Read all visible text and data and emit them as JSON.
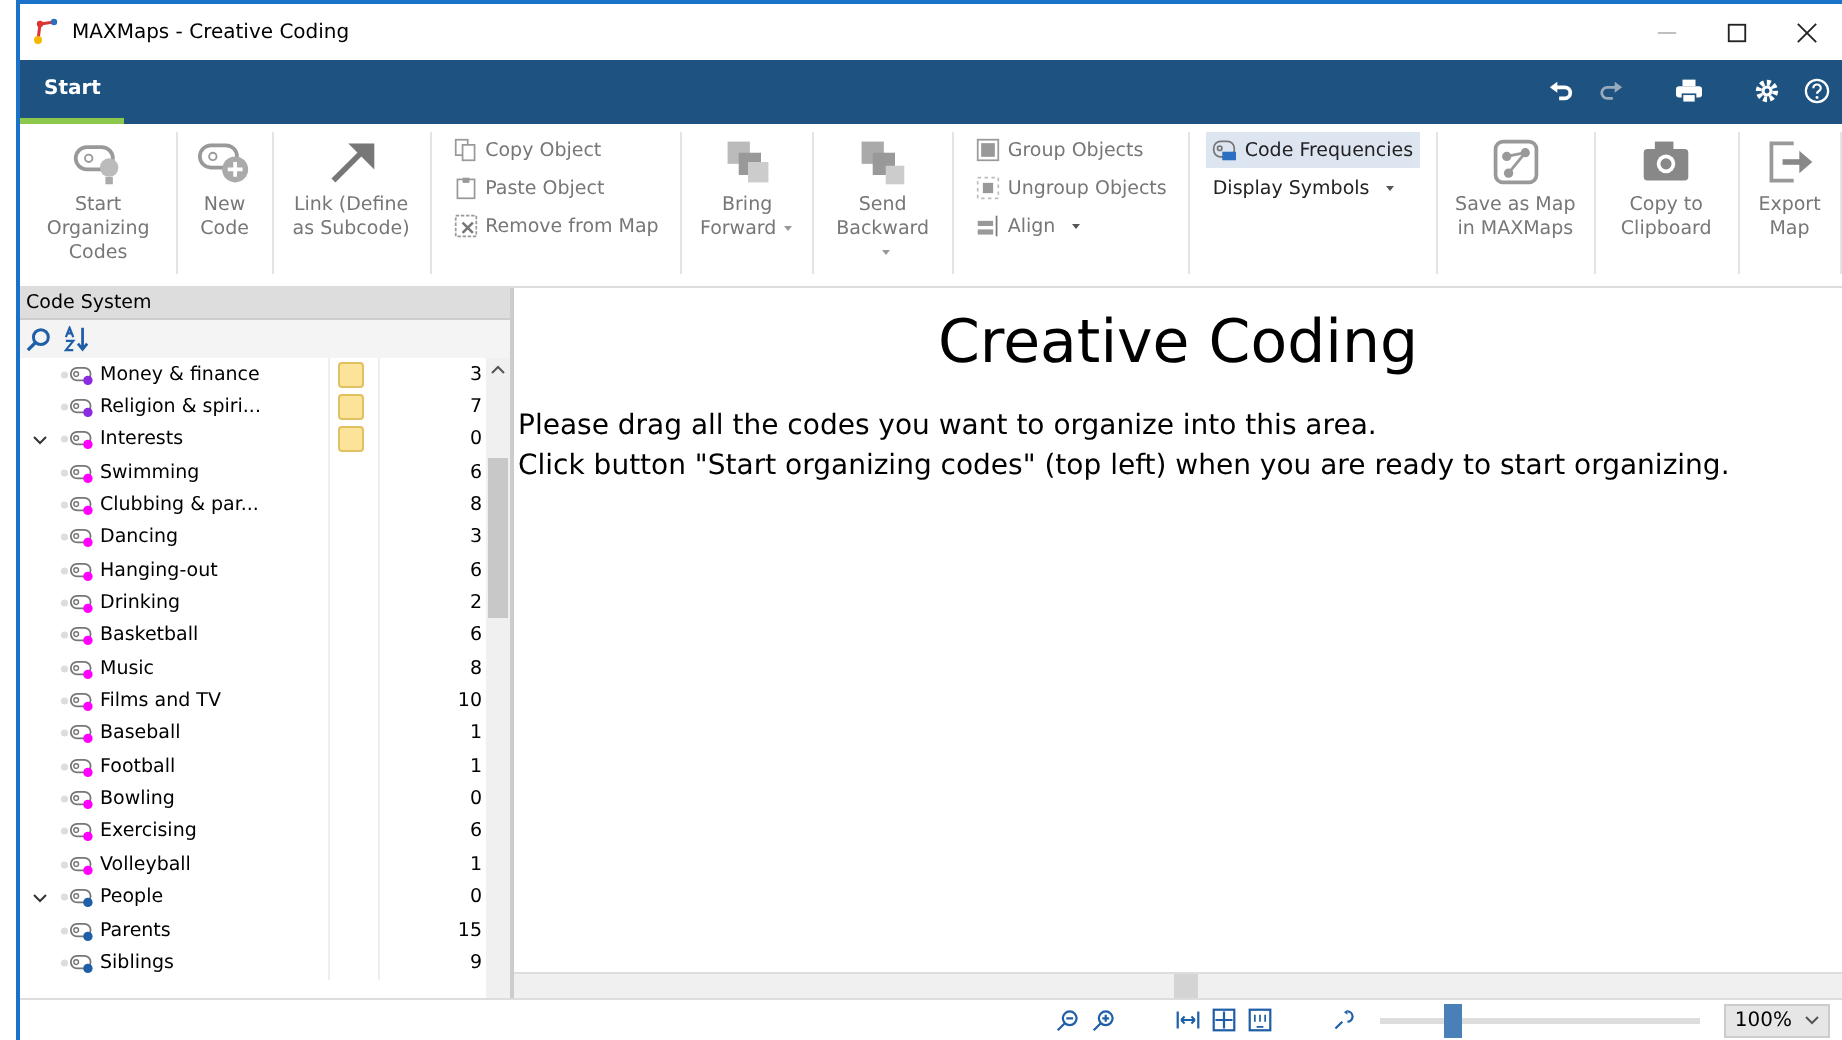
{
  "window": {
    "title": "MAXMaps - Creative Coding"
  },
  "tabs": [
    {
      "label": "Start",
      "selected": true
    }
  ],
  "ribbon": [
    {
      "kind": "large",
      "label": "Start Organizing Codes",
      "disabled": true
    },
    {
      "kind": "large",
      "label": "New Code",
      "disabled": true
    },
    {
      "kind": "large",
      "label": "Link (Define as Subcode)",
      "disabled": true
    },
    {
      "kind": "small",
      "items": [
        {
          "label": "Copy Object",
          "disabled": true
        },
        {
          "label": "Paste Object",
          "disabled": true
        },
        {
          "label": "Remove from Map",
          "disabled": true
        }
      ]
    },
    {
      "kind": "large",
      "label": "Bring Forward",
      "dropdown": true,
      "disabled": true
    },
    {
      "kind": "large",
      "label": "Send Backward",
      "dropdown": true,
      "disabled": true
    },
    {
      "kind": "small",
      "items": [
        {
          "label": "Group Objects",
          "disabled": true
        },
        {
          "label": "Ungroup Objects",
          "disabled": true
        },
        {
          "label": "Align",
          "dropdown": true,
          "disabled": true
        }
      ]
    },
    {
      "kind": "small",
      "items": [
        {
          "label": "Code Frequencies",
          "selected": true,
          "disabled": false
        },
        {
          "label": "Display Symbols",
          "dropdown": true,
          "disabled": false
        }
      ]
    },
    {
      "kind": "large",
      "label": "Save as Map in MAXMaps",
      "disabled": true
    },
    {
      "kind": "large",
      "label": "Copy to Clipboard",
      "disabled": true
    },
    {
      "kind": "large",
      "label": "Export Map",
      "disabled": true
    }
  ],
  "code_system": {
    "title": "Code System",
    "tree": [
      {
        "children": [
          {
            "label": "Money & finance",
            "memo": true,
            "count": "3",
            "color": "#8a2be2"
          },
          {
            "label": "Religion & spiri...",
            "memo": true,
            "count": "7",
            "color": "#8a2be2"
          }
        ]
      },
      {
        "label": "Interests",
        "memo": true,
        "count": "0",
        "color": "#ff00ff",
        "expanded": true,
        "children": [
          {
            "label": "Swimming",
            "memo": false,
            "count": "6",
            "color": "#ff00ff"
          },
          {
            "label": "Clubbing & par...",
            "memo": false,
            "count": "8",
            "color": "#ff00ff"
          },
          {
            "label": "Dancing",
            "memo": false,
            "count": "3",
            "color": "#ff00ff"
          },
          {
            "label": "Hanging-out",
            "memo": false,
            "count": "6",
            "color": "#ff00ff"
          },
          {
            "label": "Drinking",
            "memo": false,
            "count": "2",
            "color": "#ff00ff"
          },
          {
            "label": "Basketball",
            "memo": false,
            "count": "6",
            "color": "#ff00ff"
          },
          {
            "label": "Music",
            "memo": false,
            "count": "8",
            "color": "#ff00ff"
          },
          {
            "label": "Films and TV",
            "memo": false,
            "count": "10",
            "color": "#ff00ff"
          },
          {
            "label": "Baseball",
            "memo": false,
            "count": "1",
            "color": "#ff00ff"
          },
          {
            "label": "Football",
            "memo": false,
            "count": "1",
            "color": "#ff00ff"
          },
          {
            "label": "Bowling",
            "memo": false,
            "count": "0",
            "color": "#ff00ff"
          },
          {
            "label": "Exercising",
            "memo": false,
            "count": "6",
            "color": "#ff00ff"
          },
          {
            "label": "Volleyball",
            "memo": false,
            "count": "1",
            "color": "#ff00ff"
          }
        ]
      },
      {
        "label": "People",
        "memo": false,
        "count": "0",
        "color": "#1f5fa8",
        "expanded": true,
        "children": [
          {
            "label": "Parents",
            "memo": false,
            "count": "15",
            "color": "#1f5fa8"
          },
          {
            "label": "Siblings",
            "memo": false,
            "count": "9",
            "color": "#1f5fa8"
          }
        ]
      }
    ]
  },
  "canvas": {
    "title": "Creative Coding",
    "lines": [
      "Please drag all the codes you want to organize into this area.",
      "Click button \"Start organizing codes\" (top left) when you are ready to start organizing."
    ]
  },
  "status_bar": {
    "zoom": {
      "level": 0.2
    },
    "zoom_value": "100%"
  }
}
